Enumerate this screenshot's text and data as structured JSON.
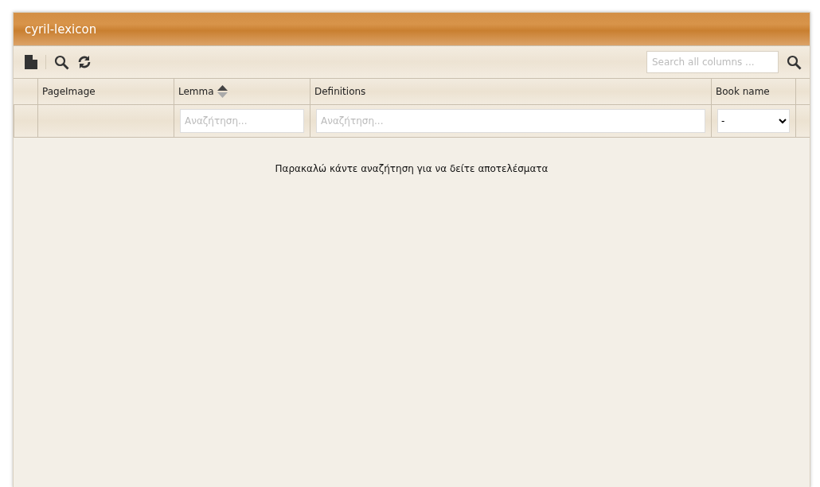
{
  "window": {
    "title": "cyril-lexicon"
  },
  "toolbar": {
    "search": {
      "placeholder": "Search all columns ..."
    }
  },
  "table": {
    "columns": [
      {
        "label": "PageImage",
        "sorted_ascending": false,
        "filter": {
          "kind": "none"
        }
      },
      {
        "label": "Lemma",
        "sorted_ascending": true,
        "filter": {
          "kind": "text",
          "placeholder": "Αναζήτηση..."
        }
      },
      {
        "label": "Definitions",
        "sorted_ascending": false,
        "filter": {
          "kind": "text",
          "placeholder": "Αναζήτηση..."
        }
      },
      {
        "label": "Book name",
        "sorted_ascending": false,
        "filter": {
          "kind": "select",
          "value": "-"
        }
      }
    ],
    "empty_message": "Παρακαλώ κάντε αναζήτηση για να δείτε αποτελέσματα"
  }
}
